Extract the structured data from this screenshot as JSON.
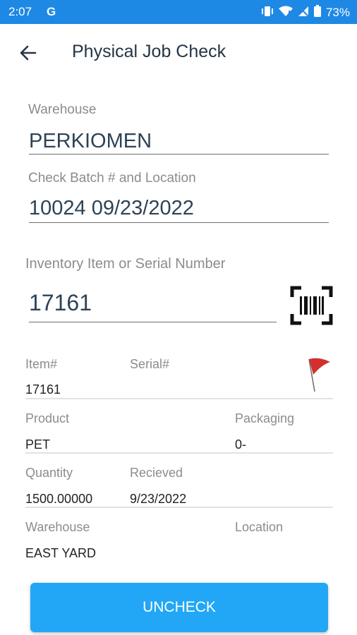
{
  "status_bar": {
    "time": "2:07",
    "carrier_icon": "G",
    "battery": "73%"
  },
  "app_bar": {
    "title": "Physical Job Check"
  },
  "form": {
    "warehouse_label": "Warehouse",
    "warehouse_value": "PERKIOMEN",
    "batch_label": "Check Batch # and Location",
    "batch_value": "10024 09/23/2022",
    "item_label": "Inventory Item or Serial Number",
    "item_value": "17161"
  },
  "details": {
    "item_label": "Item#",
    "item_value": "17161",
    "serial_label": "Serial#",
    "serial_value": "",
    "product_label": "Product",
    "product_value": "PET",
    "packaging_label": "Packaging",
    "packaging_value": "0-",
    "quantity_label": "Quantity",
    "quantity_value": "1500.00000",
    "received_label": "Recieved",
    "received_value": "9/23/2022",
    "warehouse_label": "Warehouse",
    "warehouse_value": "EAST YARD",
    "location_label": "Location",
    "location_value": ""
  },
  "actions": {
    "uncheck_label": "UNCHECK"
  },
  "colors": {
    "status_bar": "#1e88e5",
    "button": "#22a7f6",
    "flag": "#d32f2f"
  }
}
